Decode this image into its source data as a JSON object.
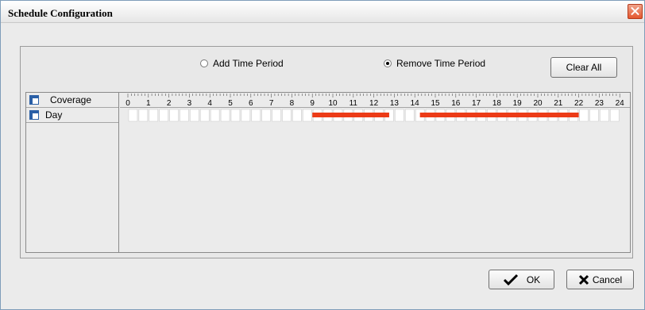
{
  "window": {
    "title": "Schedule Configuration",
    "close_icon": "close-icon"
  },
  "mode": {
    "add_label": "Add Time Period",
    "remove_label": "Remove Time Period",
    "selected": "remove"
  },
  "buttons": {
    "clear_all": "Clear All",
    "ok": "OK",
    "cancel": "Cancel"
  },
  "table": {
    "header_label": "Coverage",
    "row_label": "Day",
    "hours": [
      "0",
      "1",
      "2",
      "3",
      "4",
      "5",
      "6",
      "7",
      "8",
      "9",
      "10",
      "11",
      "12",
      "13",
      "14",
      "15",
      "16",
      "17",
      "18",
      "19",
      "20",
      "21",
      "22",
      "23",
      "24"
    ]
  },
  "schedule": {
    "periods": [
      {
        "start": 9.0,
        "end": 12.75
      },
      {
        "start": 14.25,
        "end": 22.0
      }
    ],
    "period_color": "#ec3b17"
  }
}
